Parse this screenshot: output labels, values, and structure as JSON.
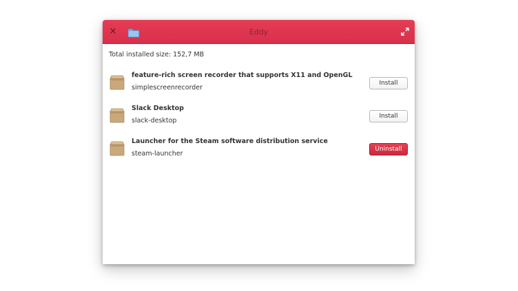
{
  "window": {
    "title": "Eddy",
    "close_glyph": "×"
  },
  "content": {
    "total_size": "Total installed size: 152,7 MB",
    "apps": [
      {
        "name": "feature-rich screen recorder that supports X11 and OpenGL",
        "package": "simplescreenrecorder",
        "action": "Install",
        "icon": "package-icon"
      },
      {
        "name": "Slack Desktop",
        "package": "slack-desktop",
        "action": "Install",
        "icon": "package-icon"
      },
      {
        "name": "Launcher for the Steam software distribution service",
        "package": "steam-launcher",
        "action": "Uninstall",
        "icon": "package-icon"
      }
    ]
  },
  "colors": {
    "titlebar": "#e03a52",
    "uninstall": "#d8304b"
  }
}
